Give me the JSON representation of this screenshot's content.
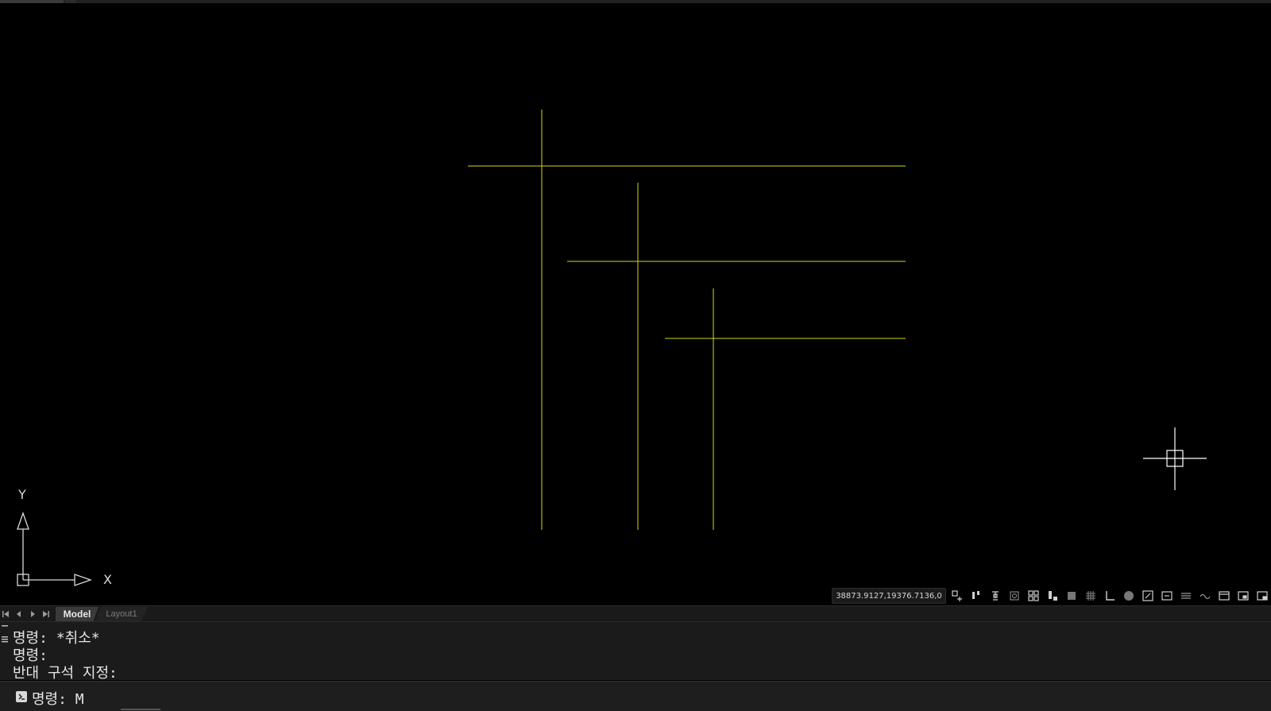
{
  "viewport": {
    "background": "#000000",
    "line_color": "#d4d41c",
    "ucs_icon": {
      "y_label": "Y",
      "x_label": "X"
    }
  },
  "status_bar": {
    "coordinates": "38873.9127,19376.7136,0",
    "icons": [
      "snap-tracking-icon",
      "snap-toggle-icon",
      "drafting-icon",
      "object-snap-icon",
      "grid-snap-icon",
      "lock-icon",
      "dynamic-ucs-icon",
      "grid-display-icon",
      "ortho-icon",
      "polar-icon",
      "isometric-icon",
      "annotation-scale-icon",
      "dimension-icon",
      "lineweight-icon",
      "transparency-icon",
      "viewport-icon",
      "layout-icon",
      "workspace-icon"
    ],
    "active_color": "#e6285a"
  },
  "tabs": {
    "model_label": "Model",
    "layout_label": "Layout1"
  },
  "command_line": {
    "history": [
      "명령: *취소*",
      "명령:",
      "반대 구석 지정:"
    ],
    "prompt": "명령: M"
  }
}
